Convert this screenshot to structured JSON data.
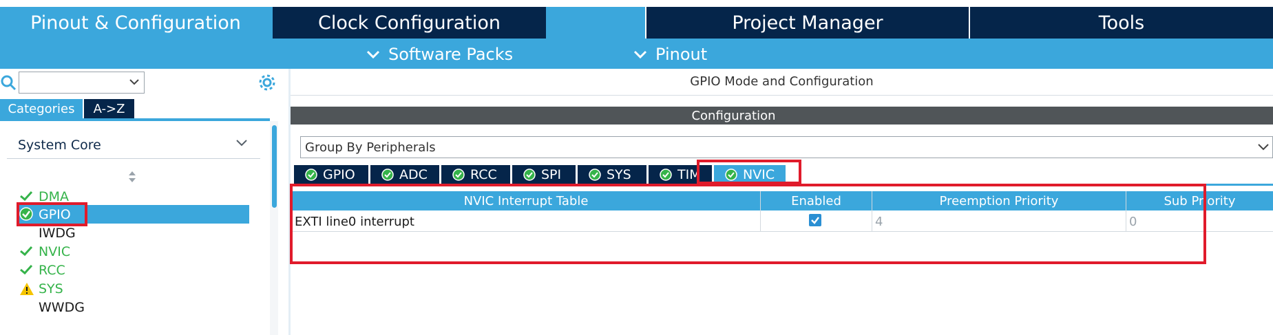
{
  "top_tabs": [
    {
      "label": "Pinout & Configuration"
    },
    {
      "label": "Clock Configuration"
    },
    {
      "label": "Project Manager"
    },
    {
      "label": "Tools"
    }
  ],
  "sub_tabs": [
    {
      "label": "Software Packs"
    },
    {
      "label": "Pinout"
    }
  ],
  "sidebar": {
    "search_value": "",
    "tabs": {
      "categories": "Categories",
      "az": "A->Z"
    },
    "category": "System Core",
    "items": [
      {
        "label": "DMA",
        "status": "ok"
      },
      {
        "label": "GPIO",
        "status": "selected"
      },
      {
        "label": "IWDG",
        "status": "none"
      },
      {
        "label": "NVIC",
        "status": "ok"
      },
      {
        "label": "RCC",
        "status": "ok"
      },
      {
        "label": "SYS",
        "status": "warning"
      },
      {
        "label": "WWDG",
        "status": "none"
      }
    ]
  },
  "main": {
    "title": "GPIO Mode and Configuration",
    "config_header": "Configuration",
    "group_by": "Group By Peripherals",
    "peripheral_tabs": [
      {
        "label": "GPIO"
      },
      {
        "label": "ADC"
      },
      {
        "label": "RCC"
      },
      {
        "label": "SPI"
      },
      {
        "label": "SYS"
      },
      {
        "label": "TIM"
      },
      {
        "label": "NVIC"
      }
    ],
    "active_tab": "NVIC",
    "table": {
      "headers": [
        "NVIC Interrupt Table",
        "Enabled",
        "Preemption Priority",
        "Sub Priority"
      ],
      "rows": [
        {
          "name": "EXTI line0 interrupt",
          "enabled": true,
          "preemption": "4",
          "sub": "0"
        }
      ]
    }
  },
  "colors": {
    "accent": "#3ba7dc",
    "navy": "#05254a",
    "ok_green": "#35b34a",
    "warning_yellow": "#f5c400",
    "annotation_red": "#e01b2b"
  }
}
